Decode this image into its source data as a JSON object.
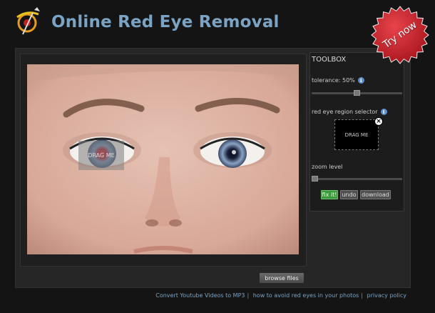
{
  "header": {
    "title": "Online Red Eye Removal",
    "badge_label": "Try now",
    "badge_color": "#c8202a"
  },
  "photo": {
    "drag_label": "DRAG ME"
  },
  "browse": {
    "label": "browse files"
  },
  "toolbox": {
    "title": "TOOLBOX",
    "tolerance_label": "tolerance: 50%",
    "tolerance_value": 0.5,
    "selector_label": "red eye region selector",
    "selector_drag_label": "DRAG ME",
    "zoom_label": "zoom level",
    "zoom_value": 0.0,
    "fix_label": "fix it!",
    "undo_label": "undo",
    "download_label": "download"
  },
  "footer": {
    "links": [
      "Convert Youtube Videos to MP3",
      "how to avoid red eyes in your photos",
      "privacy policy"
    ]
  },
  "colors": {
    "accent": "#7aa3c4",
    "fix_green": "#3c9a3c",
    "info_blue": "#5a8fd0"
  }
}
